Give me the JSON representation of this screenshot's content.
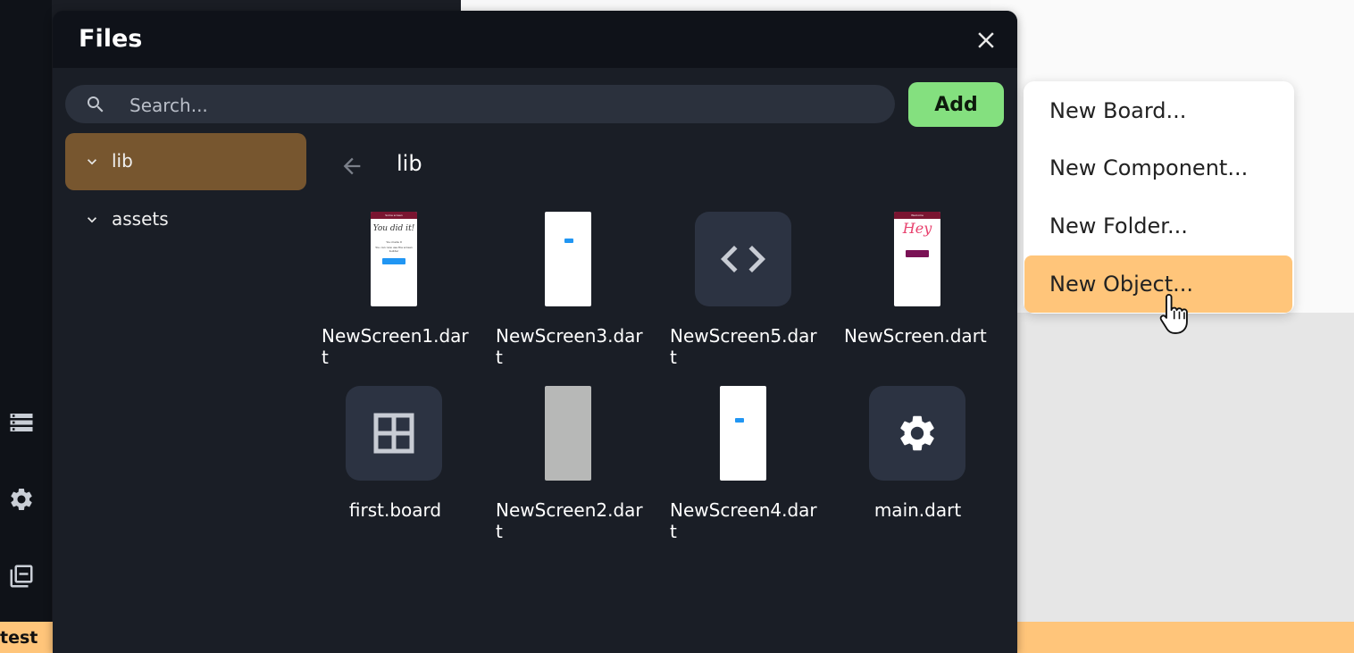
{
  "background": {
    "bottom_bar_label": "test",
    "rail_icons": [
      "storage-icon",
      "gear-icon",
      "library-icon"
    ]
  },
  "dialog": {
    "title": "Files",
    "close_icon": "close-icon",
    "search": {
      "placeholder": "Search...",
      "value": ""
    },
    "add_label": "Add",
    "tree": [
      {
        "label": "lib",
        "selected": true,
        "icon": "chevron-down-icon"
      },
      {
        "label": "assets",
        "selected": false,
        "icon": "chevron-down-icon"
      }
    ],
    "folder": {
      "back_icon": "arrow-left-icon",
      "title": "lib"
    },
    "files": [
      {
        "name": "NewScreen1.dart",
        "thumb": "screen-welcome"
      },
      {
        "name": "NewScreen3.dart",
        "thumb": "screen-blank-button"
      },
      {
        "name": "NewScreen5.dart",
        "thumb": "code-icon"
      },
      {
        "name": "NewScreen.dart",
        "thumb": "screen-hey"
      },
      {
        "name": "first.board",
        "thumb": "board-grid-icon"
      },
      {
        "name": "NewScreen2.dart",
        "thumb": "screen-grey"
      },
      {
        "name": "NewScreen4.dart",
        "thumb": "screen-blank-button"
      },
      {
        "name": "main.dart",
        "thumb": "gear-icon"
      }
    ],
    "thumb_text": {
      "welcome_header": "Some screen",
      "welcome_script": "You did it!",
      "welcome_line1": "You made it",
      "welcome_line2": "You can now use the screen builder",
      "hey_header": "Welcome",
      "hey_script": "Hey"
    }
  },
  "menu": {
    "items": [
      {
        "label": "New Board...",
        "active": false
      },
      {
        "label": "New Component...",
        "active": false
      },
      {
        "label": "New Folder...",
        "active": false
      },
      {
        "label": "New Object...",
        "active": true
      }
    ]
  },
  "colors": {
    "accent_add": "#84e07f",
    "selected_tree": "#77562f",
    "menu_active": "#ffc57a",
    "bottom_bar": "#ffc57a"
  }
}
